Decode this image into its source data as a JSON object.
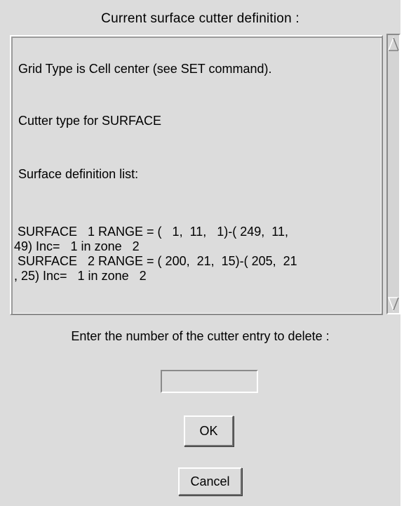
{
  "dialog": {
    "title": "Current surface cutter definition :",
    "text_lines": [
      "Grid Type is Cell center (see SET command).",
      "Cutter type for SURFACE",
      "Surface definition list:"
    ],
    "surface_lines": [
      " SURFACE   1 RANGE = (   1,  11,   1)-( 249,  11,",
      "49) Inc=   1 in zone   2",
      " SURFACE   2 RANGE = ( 200,  21,  15)-( 205,  21",
      ", 25) Inc=   1 in zone   2"
    ],
    "prompt": "Enter the number of the cutter entry to delete :",
    "entry_value": "",
    "ok_label": "OK",
    "cancel_label": "Cancel"
  },
  "scrollbar": {
    "up_icon": "triangle-up-outline",
    "down_icon": "triangle-down-outline"
  },
  "colors": {
    "background": "#dcdcdc",
    "highlight": "#ffffff",
    "shadow": "#8a8a8a"
  }
}
